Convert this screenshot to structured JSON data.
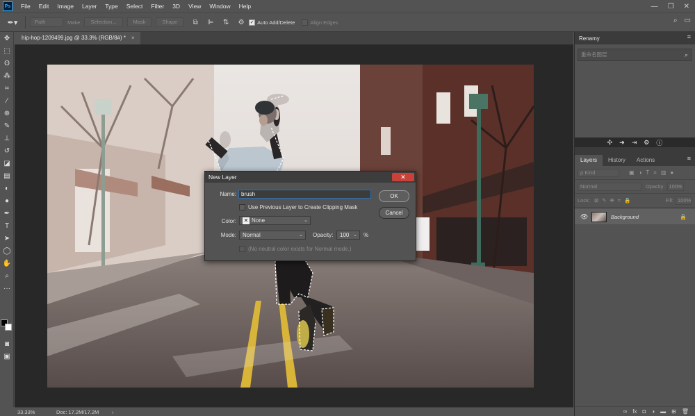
{
  "app": {
    "logo": "Ps"
  },
  "menu": [
    "File",
    "Edit",
    "Image",
    "Layer",
    "Type",
    "Select",
    "Filter",
    "3D",
    "View",
    "Window",
    "Help"
  ],
  "options_bar": {
    "path_select": "Path",
    "make_label": "Make:",
    "selection_btn": "Selection...",
    "mask_btn": "Mask",
    "shape_btn": "Shape",
    "auto_add_delete": "Auto Add/Delete",
    "align_edges": "Align Edges"
  },
  "document": {
    "tab_title": "hip-hop-1209499.jpg @ 33.3% (RGB/8#) *",
    "close": "×"
  },
  "status": {
    "zoom": "33.33%",
    "doc": "Doc: 17.2M/17.2M",
    "arrow": "›"
  },
  "renamy": {
    "title": "Renamy",
    "search_placeholder": "重命名图层"
  },
  "layers_panel": {
    "tabs": [
      "Layers",
      "History",
      "Actions"
    ],
    "kind": "ρ Kind",
    "blend": "Normal",
    "opacity_label": "Opacity:",
    "opacity_value": "100%",
    "lock_label": "Lock:",
    "fill_label": "Fill:",
    "fill_value": "100%",
    "layer_name": "Background"
  },
  "dialog": {
    "title": "New Layer",
    "name_label": "Name:",
    "name_value": "brush",
    "clip_label": "Use Previous Layer to Create Clipping Mask",
    "color_label": "Color:",
    "color_value": "None",
    "mode_label": "Mode:",
    "mode_value": "Normal",
    "opacity_label": "Opacity:",
    "opacity_value": "100",
    "opacity_unit": "%",
    "neutral_note": "(No neutral color exists for Normal mode.)",
    "ok": "OK",
    "cancel": "Cancel",
    "close": "✕"
  }
}
